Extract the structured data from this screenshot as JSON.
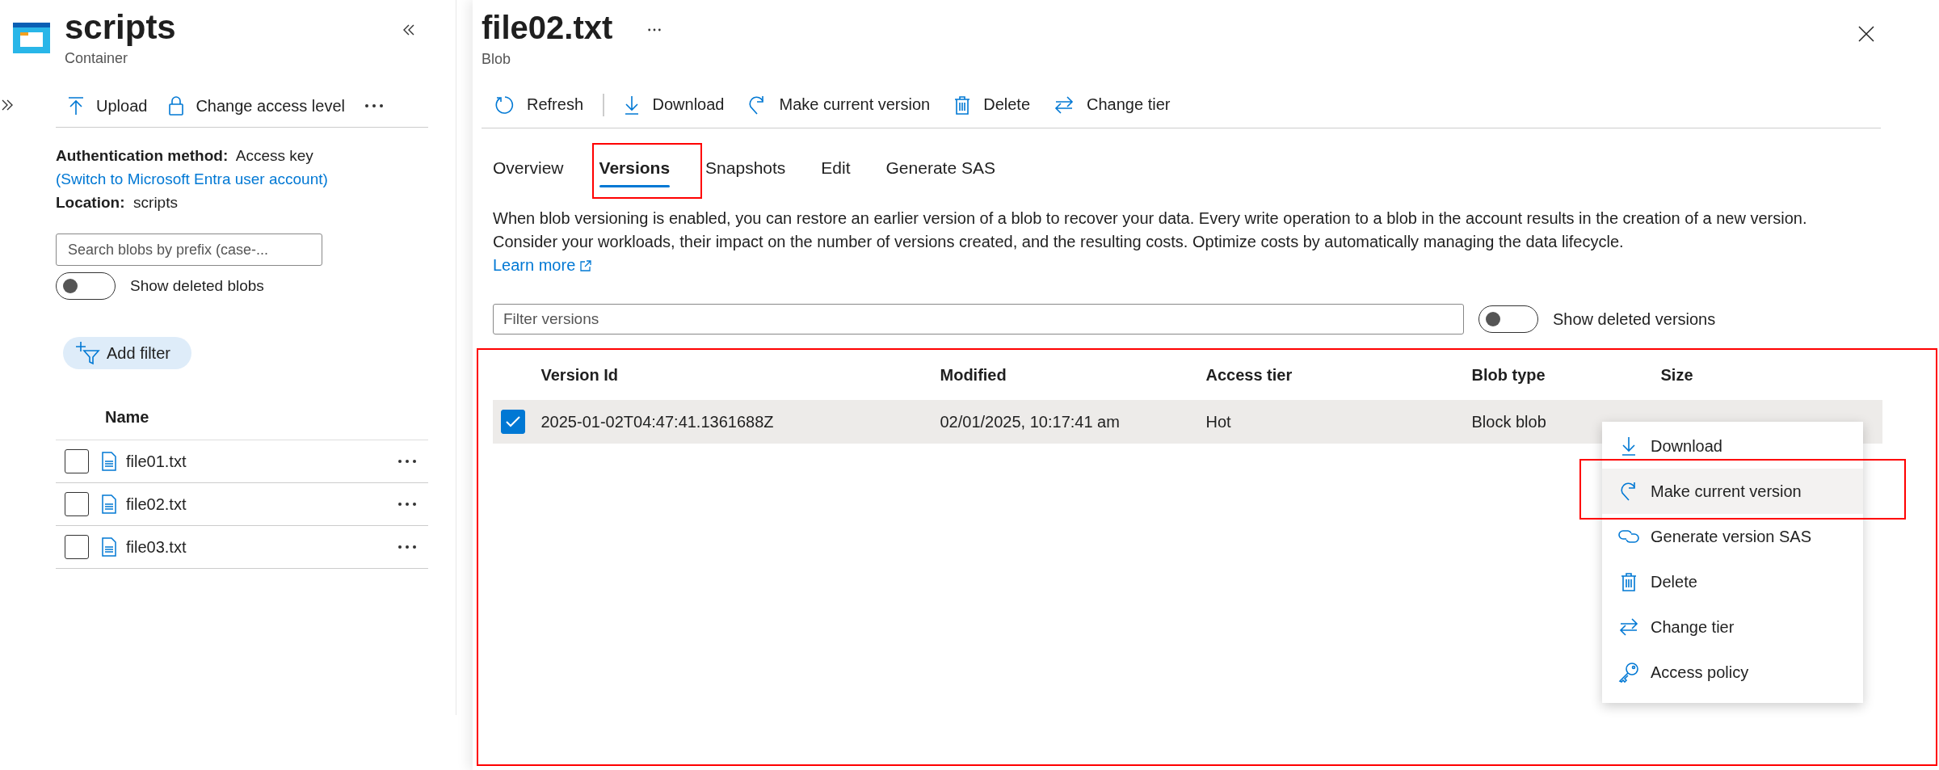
{
  "container": {
    "title": "scripts",
    "subtitle": "Container"
  },
  "left_toolbar": [
    {
      "label": "Upload"
    },
    {
      "label": "Change access level"
    }
  ],
  "auth": {
    "label": "Authentication method:",
    "value": "Access key",
    "link": "(Switch to Microsoft Entra user account)"
  },
  "location": {
    "label": "Location:",
    "value": "scripts"
  },
  "search": {
    "placeholder": "Search blobs by prefix (case-..."
  },
  "show_deleted_blobs": {
    "label": "Show deleted blobs",
    "on": false
  },
  "add_filter": "Add filter",
  "blob_list": {
    "columns": [
      "Name"
    ],
    "rows": [
      {
        "name": "file01.txt",
        "checked": false
      },
      {
        "name": "file02.txt",
        "checked": false
      },
      {
        "name": "file03.txt",
        "checked": false
      }
    ]
  },
  "blob": {
    "title": "file02.txt",
    "subtitle": "Blob"
  },
  "toolbar": [
    {
      "label": "Refresh"
    },
    {
      "label": "Download"
    },
    {
      "label": "Make current version"
    },
    {
      "label": "Delete"
    },
    {
      "label": "Change tier"
    }
  ],
  "tabs": [
    {
      "label": "Overview",
      "selected": false
    },
    {
      "label": "Versions",
      "selected": true
    },
    {
      "label": "Snapshots",
      "selected": false
    },
    {
      "label": "Edit",
      "selected": false
    },
    {
      "label": "Generate SAS",
      "selected": false
    }
  ],
  "description": "When blob versioning is enabled, you can restore an earlier version of a blob to recover your data. Every write operation to a blob in the account results in the creation of a new version. Consider your workloads, their impact on the number of versions created, and the resulting costs. Optimize costs by automatically managing the data lifecycle.",
  "learn_more": "Learn more",
  "filter": {
    "placeholder": "Filter versions"
  },
  "show_deleted_versions": {
    "label": "Show deleted versions",
    "on": false
  },
  "versions": {
    "columns": [
      "Version Id",
      "Modified",
      "Access tier",
      "Blob type",
      "Size"
    ],
    "rows": [
      {
        "version_id": "2025-01-02T04:47:41.1361688Z",
        "modified": "02/01/2025, 10:17:41 am",
        "access_tier": "Hot",
        "blob_type": "Block blob",
        "selected": true
      }
    ]
  },
  "context_menu": [
    {
      "label": "Download",
      "selected": false
    },
    {
      "label": "Make current version",
      "selected": true
    },
    {
      "label": "Generate version SAS",
      "selected": false
    },
    {
      "label": "Delete",
      "selected": false
    },
    {
      "label": "Change tier",
      "selected": false
    },
    {
      "label": "Access policy",
      "selected": false
    }
  ]
}
